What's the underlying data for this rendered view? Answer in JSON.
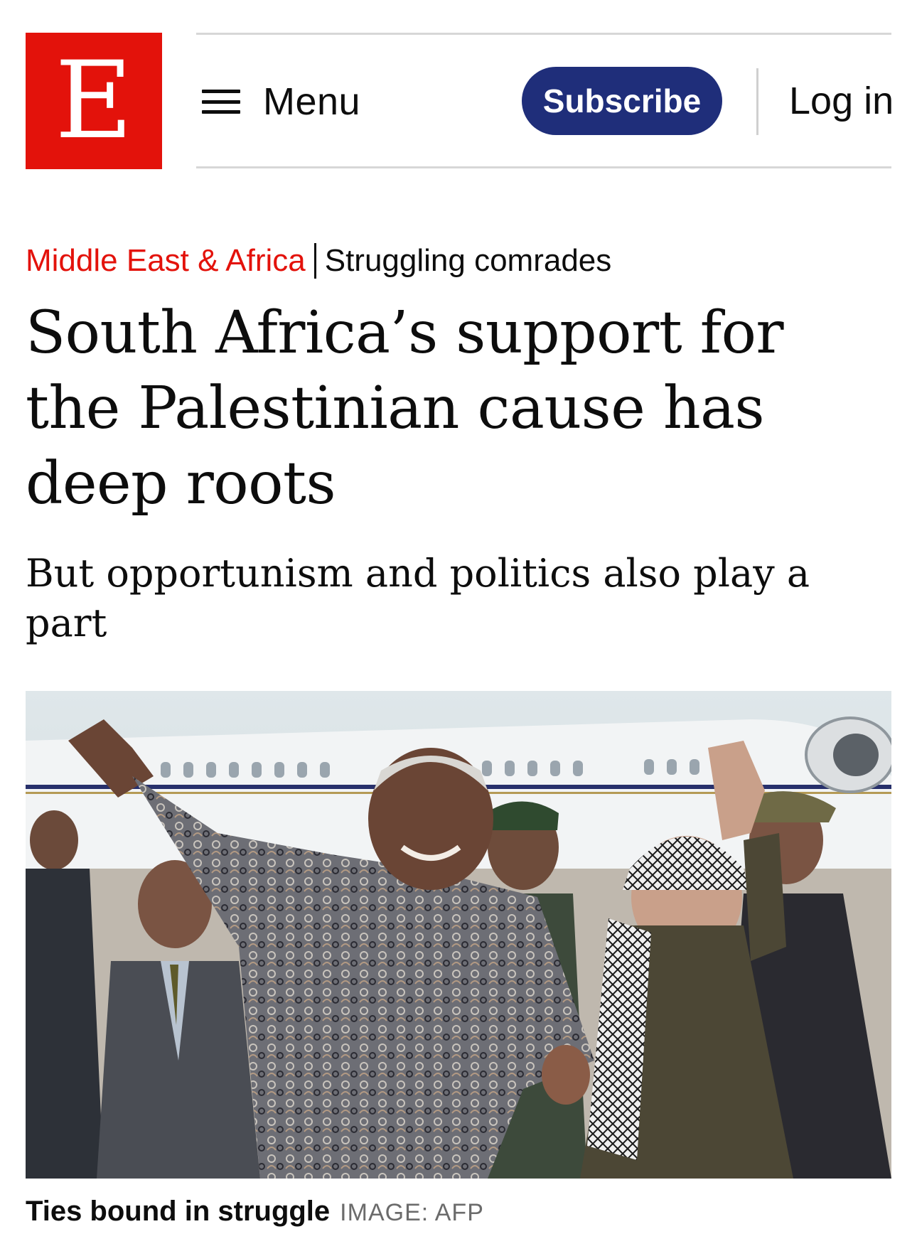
{
  "header": {
    "logo_letter": "E",
    "menu_label": "Menu",
    "subscribe_label": "Subscribe",
    "login_label": "Log in"
  },
  "article": {
    "section": "Middle East & Africa",
    "fly_title": "Struggling comrades",
    "headline": "South Africa’s support for the Palestinian cause has deep roots",
    "subheadline": "But opportunism and politics also play a part",
    "image": {
      "caption": "Ties bound in struggle",
      "credit": "IMAGE: AFP"
    }
  },
  "colors": {
    "brand_red": "#e3120b",
    "subscribe_blue": "#1f2e7a",
    "rule_gray": "#d7d7d7"
  }
}
